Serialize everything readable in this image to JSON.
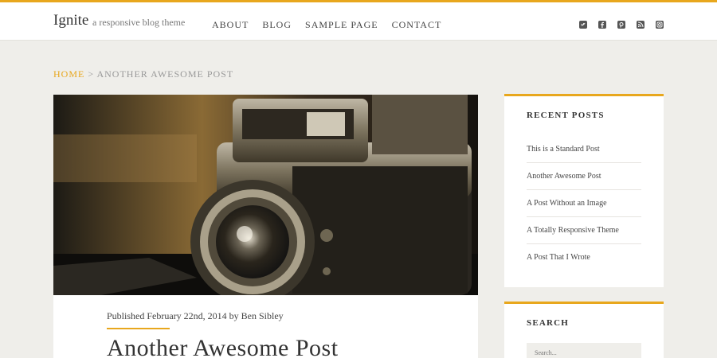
{
  "header": {
    "site_title": "Ignite",
    "tagline": "a responsive blog theme",
    "nav": [
      "ABOUT",
      "BLOG",
      "SAMPLE PAGE",
      "CONTACT"
    ],
    "social_icons": [
      "twitter-icon",
      "facebook-icon",
      "pinterest-icon",
      "rss-icon",
      "instagram-icon"
    ]
  },
  "breadcrumb": {
    "home": "HOME",
    "separator": " > ",
    "current": "ANOTHER AWESOME POST"
  },
  "post": {
    "meta": "Published February 22nd, 2014 by Ben Sibley",
    "title": "Another Awesome Post",
    "featured_image": "vintage-camera-photo"
  },
  "sidebar": {
    "recent_title": "RECENT POSTS",
    "recent_posts": [
      "This is a Standard Post",
      "Another Awesome Post",
      "A Post Without an Image",
      "A Totally Responsive Theme",
      "A Post That I Wrote"
    ],
    "search_title": "SEARCH",
    "search_placeholder": "Search..."
  },
  "colors": {
    "accent": "#e8a71d",
    "background": "#efeeea"
  }
}
